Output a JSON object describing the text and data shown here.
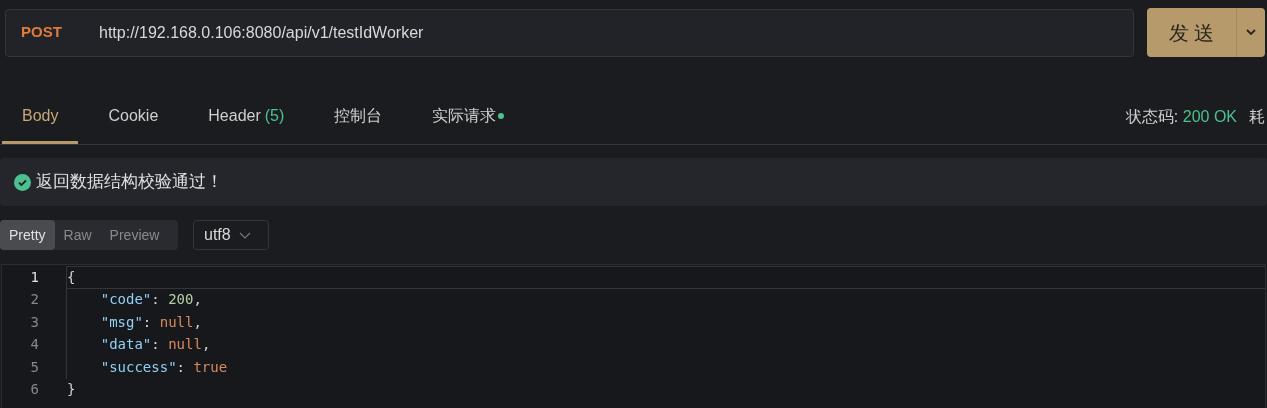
{
  "request": {
    "method": "POST",
    "url": "http://192.168.0.106:8080/api/v1/testIdWorker",
    "send_label": "发 送"
  },
  "tabs": [
    {
      "label": "Body",
      "selected": true
    },
    {
      "label": "Cookie",
      "selected": false
    },
    {
      "label": "Header",
      "count": "(5)",
      "selected": false
    },
    {
      "label": "控制台",
      "selected": false
    },
    {
      "label": "实际请求",
      "dot": true,
      "selected": false
    }
  ],
  "status": {
    "label": "状态码:",
    "value": "200 OK",
    "next_label": "耗"
  },
  "banner": {
    "text": "返回数据结构校验通过！"
  },
  "view_modes": [
    {
      "label": "Pretty",
      "selected": true
    },
    {
      "label": "Raw",
      "selected": false
    },
    {
      "label": "Preview",
      "selected": false
    }
  ],
  "encoding": {
    "value": "utf8"
  },
  "code_lines": [
    {
      "number": "1",
      "current": true,
      "tokens": [
        {
          "kind": "punct",
          "text": "{"
        }
      ]
    },
    {
      "number": "2",
      "current": false,
      "tokens": [
        {
          "kind": "key",
          "text": "    \"code\""
        },
        {
          "kind": "punct",
          "text": ": "
        },
        {
          "kind": "number",
          "text": "200"
        },
        {
          "kind": "punct",
          "text": ","
        }
      ]
    },
    {
      "number": "3",
      "current": false,
      "tokens": [
        {
          "kind": "key",
          "text": "    \"msg\""
        },
        {
          "kind": "punct",
          "text": ": "
        },
        {
          "kind": "literal",
          "text": "null"
        },
        {
          "kind": "punct",
          "text": ","
        }
      ]
    },
    {
      "number": "4",
      "current": false,
      "tokens": [
        {
          "kind": "key",
          "text": "    \"data\""
        },
        {
          "kind": "punct",
          "text": ": "
        },
        {
          "kind": "literal",
          "text": "null"
        },
        {
          "kind": "punct",
          "text": ","
        }
      ]
    },
    {
      "number": "5",
      "current": false,
      "tokens": [
        {
          "kind": "key",
          "text": "    \"success\""
        },
        {
          "kind": "punct",
          "text": ": "
        },
        {
          "kind": "literal",
          "text": "true"
        }
      ]
    },
    {
      "number": "6",
      "current": false,
      "tokens": [
        {
          "kind": "punct",
          "text": "}"
        }
      ]
    }
  ]
}
